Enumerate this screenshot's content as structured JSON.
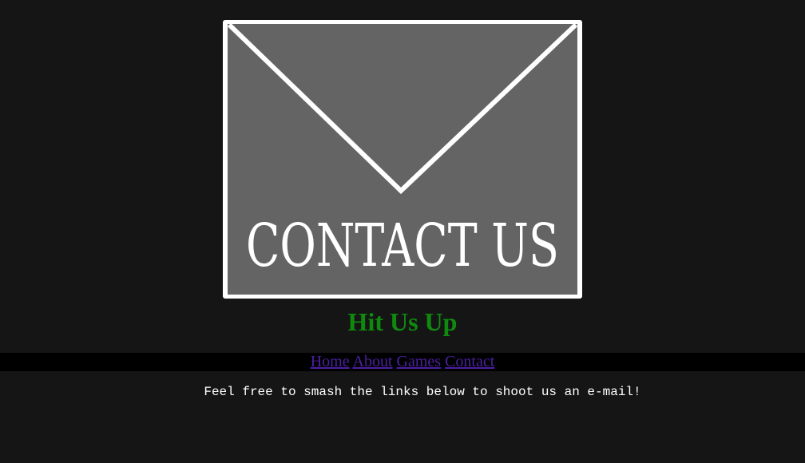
{
  "banner": {
    "text": "CONTACT US",
    "icon": "envelope-icon",
    "colors": {
      "frame": "#ffffff",
      "fill": "#646464",
      "lines": "#ffffff"
    }
  },
  "headline": {
    "text": "Hit Us Up",
    "color": "#0f8a0f"
  },
  "nav": {
    "link_color": "#4b1fa0",
    "background": "#000000",
    "items": [
      {
        "label": "Home"
      },
      {
        "label": "About"
      },
      {
        "label": "Games"
      },
      {
        "label": "Contact"
      }
    ]
  },
  "body": {
    "text": "Feel free to smash the links below to shoot us an e-mail!",
    "color": "#ffffff"
  },
  "page": {
    "background": "#151515"
  }
}
